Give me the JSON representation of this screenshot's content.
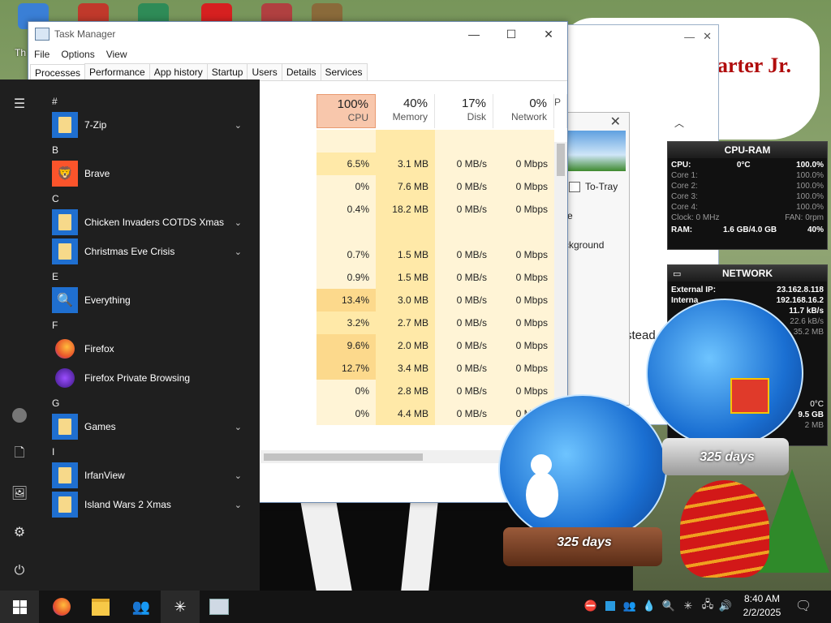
{
  "desktop": {
    "icon_label_partial": "Th",
    "banner_line1": "e",
    "banner_line2": "arter Jr."
  },
  "task_manager": {
    "title": "Task Manager",
    "menu": [
      "File",
      "Options",
      "View"
    ],
    "tabs": [
      "Processes",
      "Performance",
      "App history",
      "Startup",
      "Users",
      "Details",
      "Services"
    ],
    "active_tab": "Processes",
    "columns": [
      {
        "pct": "100%",
        "name": "CPU"
      },
      {
        "pct": "40%",
        "name": "Memory"
      },
      {
        "pct": "17%",
        "name": "Disk"
      },
      {
        "pct": "0%",
        "name": "Network"
      },
      {
        "pct": "",
        "name": "P"
      }
    ],
    "rows": [
      {
        "cpu": "",
        "mem": "",
        "disk": "",
        "net": ""
      },
      {
        "cpu": "6.5%",
        "mem": "3.1 MB",
        "disk": "0 MB/s",
        "net": "0 Mbps"
      },
      {
        "cpu": "0%",
        "mem": "7.6 MB",
        "disk": "0 MB/s",
        "net": "0 Mbps"
      },
      {
        "cpu": "0.4%",
        "mem": "18.2 MB",
        "disk": "0 MB/s",
        "net": "0 Mbps"
      },
      {
        "cpu": "",
        "mem": "",
        "disk": "",
        "net": ""
      },
      {
        "cpu": "0.7%",
        "mem": "1.5 MB",
        "disk": "0 MB/s",
        "net": "0 Mbps"
      },
      {
        "cpu": "0.9%",
        "mem": "1.5 MB",
        "disk": "0 MB/s",
        "net": "0 Mbps"
      },
      {
        "cpu": "13.4%",
        "mem": "3.0 MB",
        "disk": "0 MB/s",
        "net": "0 Mbps"
      },
      {
        "cpu": "3.2%",
        "mem": "2.7 MB",
        "disk": "0 MB/s",
        "net": "0 Mbps"
      },
      {
        "cpu": "9.6%",
        "mem": "2.0 MB",
        "disk": "0 MB/s",
        "net": "0 Mbps"
      },
      {
        "cpu": "12.7%",
        "mem": "3.4 MB",
        "disk": "0 MB/s",
        "net": "0 Mbps"
      },
      {
        "cpu": "0%",
        "mem": "2.8 MB",
        "disk": "0 MB/s",
        "net": "0 Mbps"
      },
      {
        "cpu": "0%",
        "mem": "4.4 MB",
        "disk": "0 MB/s",
        "net": "0 Mbps"
      }
    ]
  },
  "popup": {
    "to_tray": "To-Tray",
    "line_e": "e",
    "background_partial": "ckground",
    "instead_partial": "stead"
  },
  "start_menu": {
    "sections": [
      {
        "letter": "#",
        "apps": [
          {
            "name": "7-Zip",
            "icon": "folder-icon",
            "expandable": true
          }
        ]
      },
      {
        "letter": "B",
        "apps": [
          {
            "name": "Brave",
            "icon": "brave-icon",
            "expandable": false
          }
        ]
      },
      {
        "letter": "C",
        "apps": [
          {
            "name": "Chicken Invaders COTDS Xmas",
            "icon": "folder-icon",
            "expandable": true
          },
          {
            "name": "Christmas Eve Crisis",
            "icon": "folder-icon",
            "expandable": true
          }
        ]
      },
      {
        "letter": "E",
        "apps": [
          {
            "name": "Everything",
            "icon": "magnifier-icon",
            "expandable": false
          }
        ]
      },
      {
        "letter": "F",
        "apps": [
          {
            "name": "Firefox",
            "icon": "firefox-icon",
            "expandable": false
          },
          {
            "name": "Firefox Private Browsing",
            "icon": "firefox-private-icon",
            "expandable": false
          }
        ]
      },
      {
        "letter": "G",
        "apps": [
          {
            "name": "Games",
            "icon": "folder-icon",
            "expandable": true
          }
        ]
      },
      {
        "letter": "I",
        "apps": [
          {
            "name": "IrfanView",
            "icon": "folder-icon",
            "expandable": true
          },
          {
            "name": "Island Wars 2 Xmas",
            "icon": "folder-icon",
            "expandable": true
          }
        ]
      }
    ]
  },
  "cpu_ram_gadget": {
    "title": "CPU-RAM",
    "cpu_label": "CPU:",
    "cpu_temp": "0°C",
    "cpu_total": "100.0%",
    "cores": [
      {
        "label": "Core 1:",
        "value": "100.0%"
      },
      {
        "label": "Core 2:",
        "value": "100.0%"
      },
      {
        "label": "Core 3:",
        "value": "100.0%"
      },
      {
        "label": "Core 4:",
        "value": "100.0%"
      }
    ],
    "clock": "Clock: 0 MHz",
    "fan": "FAN: 0rpm",
    "ram_label": "RAM:",
    "ram_value": "1.6 GB/4.0 GB",
    "ram_pct": "40%"
  },
  "network_gadget": {
    "title": "NETWORK",
    "external_ip_label": "External IP:",
    "external_ip": "23.162.8.118",
    "internal_ip_label": "Interna",
    "internal_ip": "192.168.16.2",
    "up_rate": "11.7 kB/s",
    "down_rate": "22.6 kB/s",
    "total": "35.2 MB",
    "temp": "0°C",
    "storage": "9.5 GB",
    "storage_unit": "2 MB"
  },
  "snow_globes": {
    "left_label": "325 days",
    "right_label": "325 days"
  },
  "taskbar": {
    "time": "8:40 AM",
    "date": "2/2/2025"
  },
  "colors": {
    "cpu_header": "#f8c7ac",
    "heat_low": "#fff4d6",
    "heat_mid": "#ffe9a8",
    "heat_high": "#fcd98c",
    "start_bg": "#1f1f1f",
    "folder_tile": "#1f6fd0"
  }
}
